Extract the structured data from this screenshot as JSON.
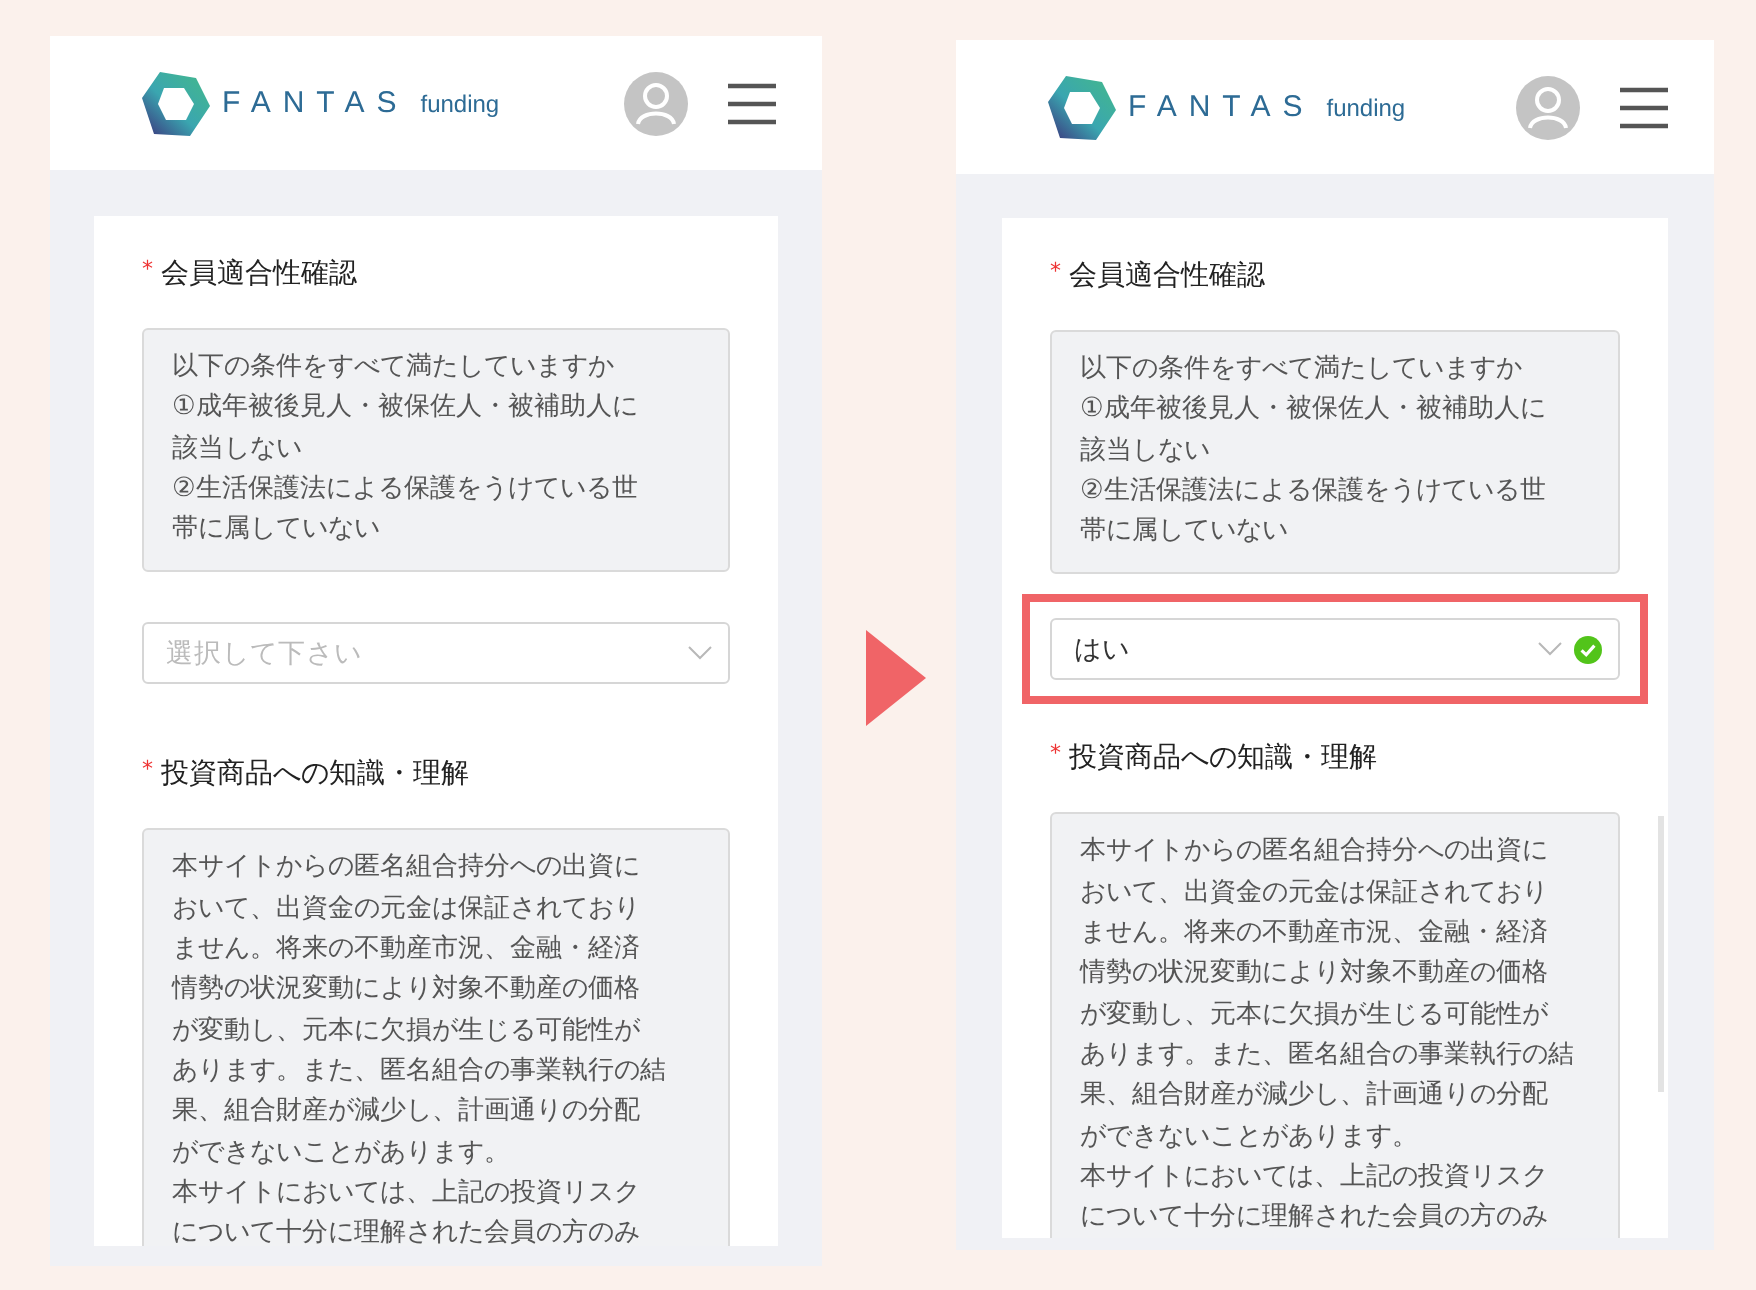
{
  "panels": [
    {
      "header": {
        "logo_word": "FANTAS",
        "logo_sub": "funding"
      },
      "questions": [
        {
          "mark": "*",
          "label": "会員適合性確認",
          "notice_lines": [
            "以下の条件をすべて満たしていますか",
            "①成年被後見人・被保佐人・被補助人に",
            "該当しない",
            "②生活保護法による保護をうけている世",
            "帯に属していない"
          ],
          "answer": {
            "placeholder": "選択して下さい",
            "highlighted": false
          }
        },
        {
          "mark": "*",
          "label": "投資商品への知識・理解",
          "notice_lines": [
            "本サイトからの匿名組合持分への出資に",
            "おいて、出資金の元金は保証されており",
            "ません。将来の不動産市況、金融・経済",
            "情勢の状況変動により対象不動産の価格",
            "が変動し、元本に欠損が生じる可能性が",
            "あります。また、匿名組合の事業執行の結",
            "果、組合財産が減少し、計画通りの分配",
            "ができないことがあります。",
            "本サイトにおいては、上記の投資リスク",
            "について十分に理解された会員の方のみ"
          ]
        }
      ]
    },
    {
      "header": {
        "logo_word": "FANTAS",
        "logo_sub": "funding"
      },
      "questions": [
        {
          "mark": "*",
          "label": "会員適合性確認",
          "notice_lines": [
            "以下の条件をすべて満たしていますか",
            "①成年被後見人・被保佐人・被補助人に",
            "該当しない",
            "②生活保護法による保護をうけている世",
            "帯に属していない"
          ],
          "answer": {
            "value": "はい",
            "highlighted": true,
            "valid": true
          }
        },
        {
          "mark": "*",
          "label": "投資商品への知識・理解",
          "notice_lines": [
            "本サイトからの匿名組合持分への出資に",
            "おいて、出資金の元金は保証されており",
            "ません。将来の不動産市況、金融・経済",
            "情勢の状況変動により対象不動産の価格",
            "が変動し、元本に欠損が生じる可能性が",
            "あります。また、匿名組合の事業執行の結",
            "果、組合財産が減少し、計画通りの分配",
            "ができないことがあります。",
            "本サイトにおいては、上記の投資リスク",
            "について十分に理解された会員の方のみ"
          ],
          "scrollable": true
        }
      ]
    }
  ]
}
